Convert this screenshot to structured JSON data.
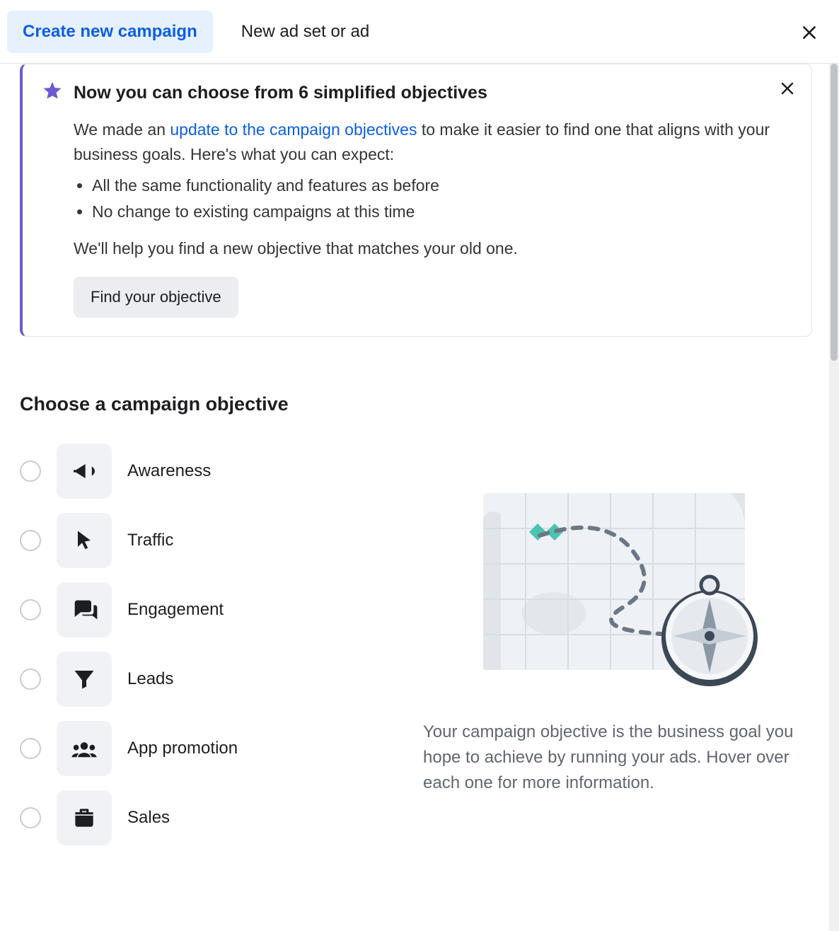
{
  "tabs": {
    "create": "Create new campaign",
    "newadset": "New ad set or ad"
  },
  "banner": {
    "title": "Now you can choose from 6 simplified objectives",
    "body_prefix": "We made an ",
    "body_link": "update to the campaign objectives",
    "body_suffix": " to make it easier to find one that aligns with your business goals. Here's what you can expect:",
    "bullets": [
      "All the same functionality and features as before",
      "No change to existing campaigns at this time"
    ],
    "helper": "We'll help you find a new objective that matches your old one.",
    "find_button": "Find your objective"
  },
  "section": {
    "title": "Choose a campaign objective"
  },
  "objectives": [
    {
      "label": "Awareness"
    },
    {
      "label": "Traffic"
    },
    {
      "label": "Engagement"
    },
    {
      "label": "Leads"
    },
    {
      "label": "App promotion"
    },
    {
      "label": "Sales"
    }
  ],
  "info": {
    "text": "Your campaign objective is the business goal you hope to achieve by running your ads. Hover over each one for more information."
  }
}
